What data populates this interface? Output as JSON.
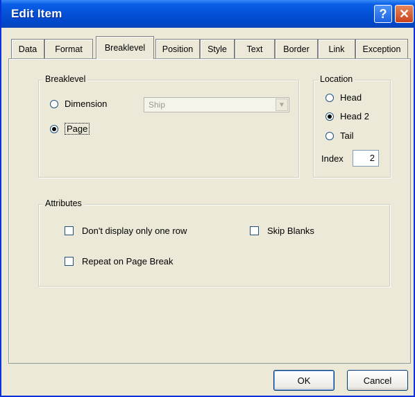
{
  "window": {
    "title": "Edit Item"
  },
  "title_buttons": {
    "help": "?",
    "close": "✕"
  },
  "tabs": [
    {
      "label": "Data"
    },
    {
      "label": "Format"
    },
    {
      "label": "Breaklevel"
    },
    {
      "label": "Position"
    },
    {
      "label": "Style"
    },
    {
      "label": "Text"
    },
    {
      "label": "Border"
    },
    {
      "label": "Link"
    },
    {
      "label": "Exception"
    }
  ],
  "active_tab": "Breaklevel",
  "breaklevel": {
    "group_label": "Breaklevel",
    "dimension_label": "Dimension",
    "dimension_select_value": "Ship",
    "page_label": "Page",
    "selected": "Page"
  },
  "location": {
    "group_label": "Location",
    "head_label": "Head",
    "head2_label": "Head 2",
    "tail_label": "Tail",
    "selected": "Head 2",
    "index_label": "Index",
    "index_value": "2"
  },
  "attributes": {
    "group_label": "Attributes",
    "dont_display_label": "Don't display only one row",
    "skip_blanks_label": "Skip Blanks",
    "repeat_label": "Repeat on Page Break"
  },
  "buttons": {
    "ok": "OK",
    "cancel": "Cancel"
  }
}
